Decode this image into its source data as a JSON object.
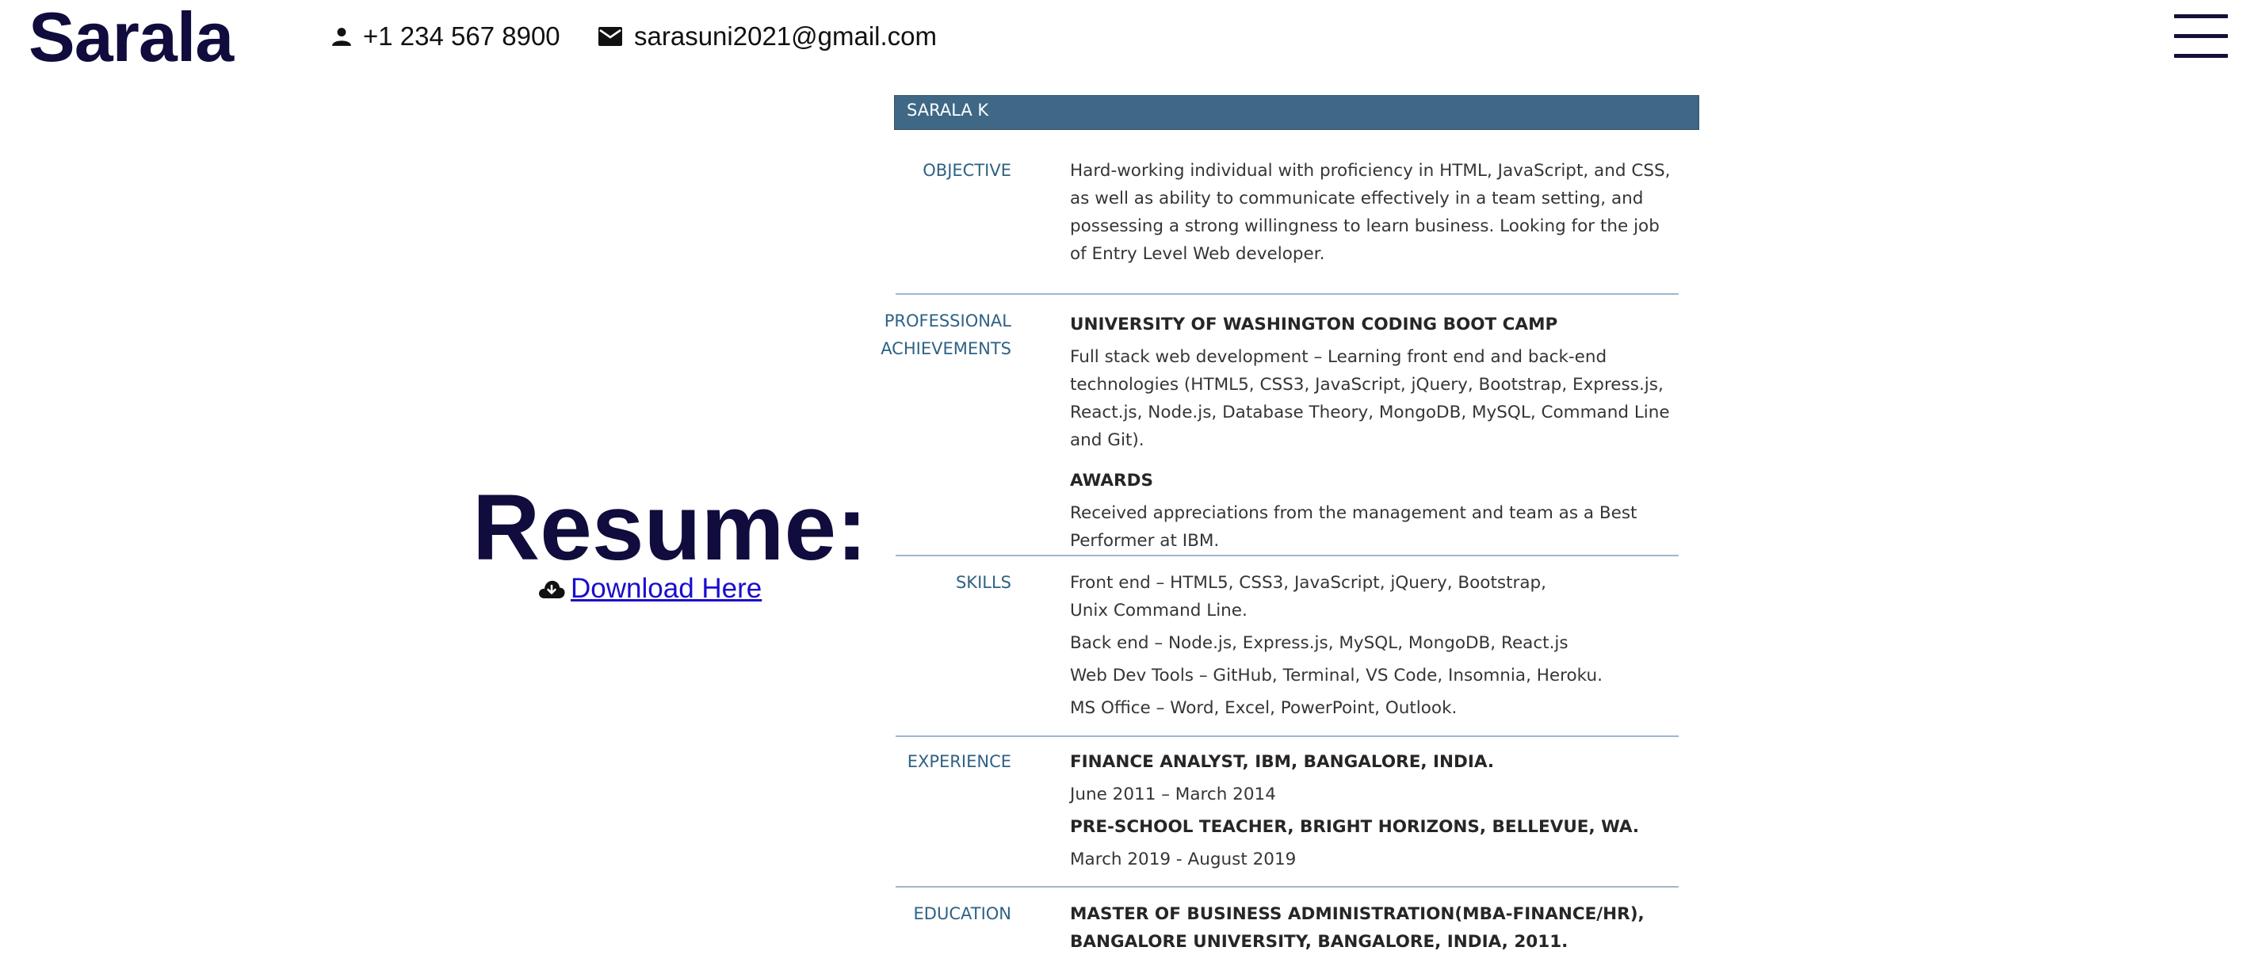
{
  "header": {
    "brand": "Sarala",
    "phone": "+1 234 567 8900",
    "email": "sarasuni2021@gmail.com",
    "icons": {
      "phone": "person-icon",
      "email": "mail-icon",
      "menu": "hamburger-menu-icon"
    }
  },
  "resume_panel": {
    "title": "Resume:",
    "download_label": "Download Here",
    "download_icon": "cloud-download-icon"
  },
  "document": {
    "name": "SARALA K",
    "header_color": "#3e6885",
    "label_color": "#2e6285",
    "objective": {
      "label": "OBJECTIVE",
      "text": "Hard-working individual with proficiency in HTML, JavaScript, and CSS, as well as ability to communicate effectively in a team setting, and possessing a strong willingness to learn business. Looking for the job of Entry Level Web developer."
    },
    "achievements": {
      "label_line1": "PROFESSIONAL",
      "label_line2": "ACHIEVEMENTS",
      "bootcamp_title": "UNIVERSITY OF WASHINGTON CODING BOOT CAMP",
      "bootcamp_text": "Full stack web development – Learning front end and back-end technologies (HTML5, CSS3, JavaScript, jQuery, Bootstrap, Express.js, React.js, Node.js, Database Theory, MongoDB, MySQL, Command Line and Git).",
      "awards_title": "AWARDS",
      "awards_text": "Received appreciations from the management and team as a Best Performer at IBM."
    },
    "skills": {
      "label": "SKILLS",
      "items": [
        "Front end – HTML5, CSS3, JavaScript, jQuery, Bootstrap, Unix Command Line.",
        "Back end – Node.js, Express.js, MySQL, MongoDB, React.js",
        "Web Dev Tools – GitHub, Terminal, VS Code, Insomnia, Heroku.",
        "MS Office – Word, Excel, PowerPoint, Outlook."
      ]
    },
    "experience": {
      "label": "EXPERIENCE",
      "jobs": [
        {
          "title": "FINANCE ANALYST, IBM, BANGALORE, INDIA.",
          "dates": "June 2011 – March 2014"
        },
        {
          "title": "PRE-SCHOOL TEACHER, BRIGHT HORIZONS, BELLEVUE, WA.",
          "dates": "March 2019 - August 2019"
        }
      ]
    },
    "education": {
      "label": "EDUCATION",
      "degree": "MASTER OF BUSINESS ADMINISTRATION(MBA-FINANCE/HR), BANGALORE UNIVERSITY, BANGALORE, INDIA, 2011."
    }
  }
}
